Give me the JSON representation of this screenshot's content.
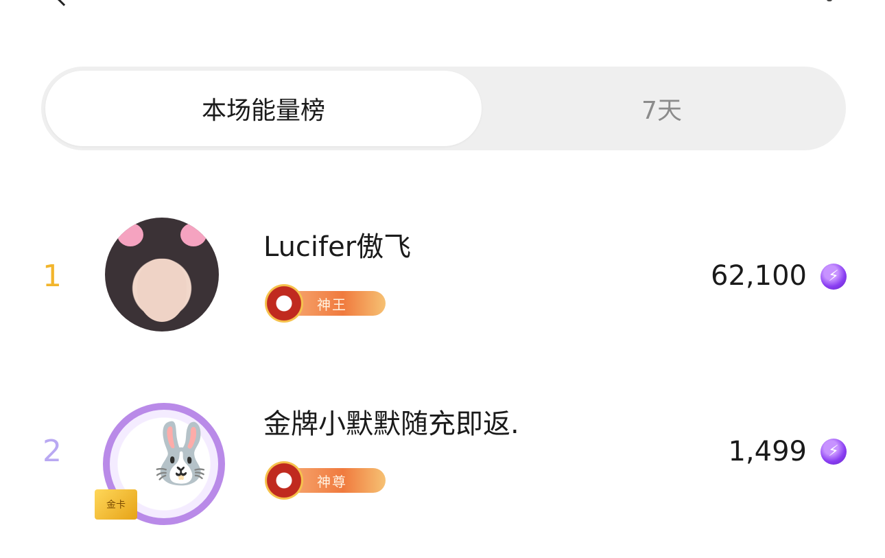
{
  "tabs": [
    {
      "label": "本场能量榜",
      "active": true
    },
    {
      "label": "7天",
      "active": false
    }
  ],
  "ranking": [
    {
      "rank": "1",
      "name": "Lucifer傲飞",
      "badge": "神王",
      "score": "62,100",
      "score_icon": "energy-bolt-icon"
    },
    {
      "rank": "2",
      "name": "金牌小默默随充即返.",
      "badge": "神尊",
      "score": "1,499",
      "score_icon": "energy-bolt-icon"
    }
  ],
  "avatar_card_label": "金卡",
  "colors": {
    "rank1": "#f2b52c",
    "rank2": "#b9a8f2",
    "energy_icon": "#8a3ef2",
    "badge_orange": "#f07a3e",
    "tab_bg": "#efefef"
  }
}
